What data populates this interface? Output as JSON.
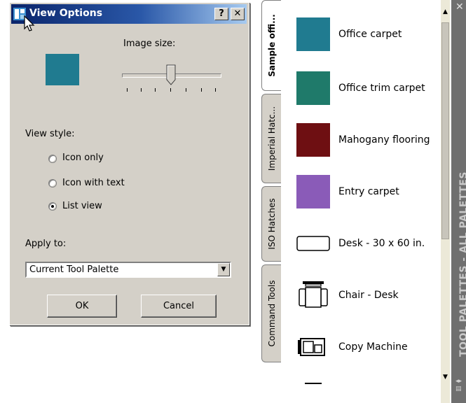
{
  "dialog": {
    "title": "View Options",
    "help_label": "?",
    "close_label": "✕",
    "image_size_label": "Image size:",
    "view_style_label": "View style:",
    "view_styles": [
      {
        "label": "Icon only",
        "selected": false
      },
      {
        "label": "Icon with text",
        "selected": false
      },
      {
        "label": "List view",
        "selected": true
      }
    ],
    "apply_to_label": "Apply to:",
    "apply_to_value": "Current Tool Palette",
    "ok_label": "OK",
    "cancel_label": "Cancel",
    "preview_color": "#207b90"
  },
  "palette": {
    "tabs": [
      {
        "label": "Sample offi...",
        "active": true
      },
      {
        "label": "Imperial Hatc...",
        "active": false
      },
      {
        "label": "ISO Hatches",
        "active": false
      },
      {
        "label": "Command Tools",
        "active": false
      }
    ],
    "items": [
      {
        "label": "Office carpet",
        "color": "#207b90"
      },
      {
        "label": "Office trim carpet",
        "color": "#1f7a6a"
      },
      {
        "label": "Mahogany flooring",
        "color": "#6e0f12"
      },
      {
        "label": "Entry carpet",
        "color": "#8a5bb8"
      },
      {
        "label": "Desk - 30 x 60 in.",
        "icon": "desk-icon"
      },
      {
        "label": "Chair - Desk",
        "icon": "chair-icon"
      },
      {
        "label": "Copy Machine",
        "icon": "copy-machine-icon"
      }
    ],
    "side_title": "TOOL PALETTES - ALL PALETTES"
  }
}
